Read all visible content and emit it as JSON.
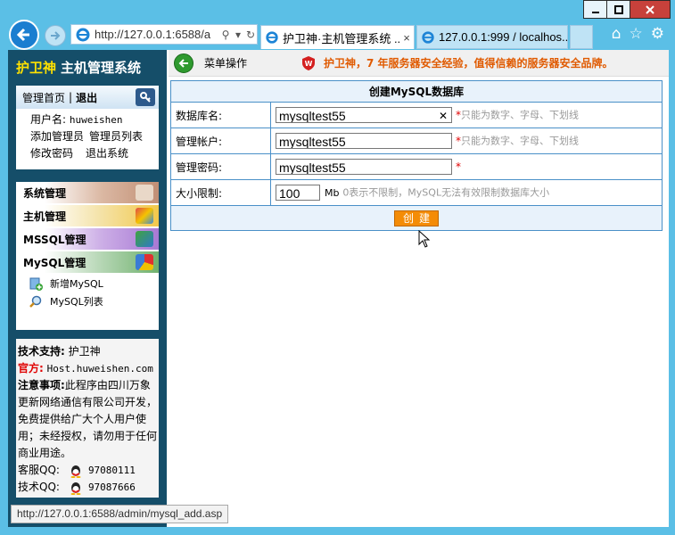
{
  "browser": {
    "url": "http://127.0.0.1:6588/a",
    "tabs": [
      {
        "title": "护卫神·主机管理系统 ...",
        "close": "×"
      },
      {
        "title": "127.0.0.1:999 / localhos..."
      }
    ],
    "status_url": "http://127.0.0.1:6588/admin/mysql_add.asp"
  },
  "sidebar": {
    "brand_highlight": "护卫神",
    "brand_rest": "主机管理系统",
    "home": "管理首页",
    "sep": "|",
    "logout": "退出",
    "user_label": "用户名:",
    "user_value": "huweishen",
    "links": [
      "添加管理员",
      "管理员列表",
      "修改密码",
      "退出系统"
    ],
    "menus": [
      "系统管理",
      "主机管理",
      "MSSQL管理",
      "MySQL管理"
    ],
    "mysql_items": [
      "新增MySQL",
      "MySQL列表"
    ],
    "support_label": "技术支持:",
    "support_value": "护卫神",
    "official_label": "官方:",
    "official_value": "Host.huweishen.com",
    "notice_label": "注意事项:",
    "notice_text": "此程序由四川万象更新网络通信有限公司开发，免费提供给广大个人用户使用；未经授权，请勿用于任何商业用途。",
    "qq_service_label": "客服QQ:",
    "qq_service": "97080111",
    "qq_tech_label": "技术QQ:",
    "qq_tech": "97087666"
  },
  "topbar": {
    "menu_op": "菜单操作",
    "slogan": "护卫神，7 年服务器安全经验，值得信赖的服务器安全品牌。"
  },
  "form": {
    "title": "创建MySQL数据库",
    "rows": [
      {
        "label": "数据库名:",
        "value": "mysqltest55",
        "star": "*",
        "hint": "只能为数字、字母、下划线"
      },
      {
        "label": "管理帐户:",
        "value": "mysqltest55",
        "star": "*",
        "hint": "只能为数字、字母、下划线"
      },
      {
        "label": "管理密码:",
        "value": "mysqltest55",
        "star": "*",
        "hint": ""
      }
    ],
    "size_label": "大小限制:",
    "size_value": "100",
    "size_unit": "Mb",
    "size_hint": "0表示不限制，MySQL无法有效限制数据库大小",
    "submit": "创建"
  },
  "colors": {
    "sidebar_bg": "#154e69",
    "brand_accent": "#ffe100",
    "form_border": "#4a90c8",
    "button": "#f48c06",
    "slogan": "#e05a00"
  }
}
